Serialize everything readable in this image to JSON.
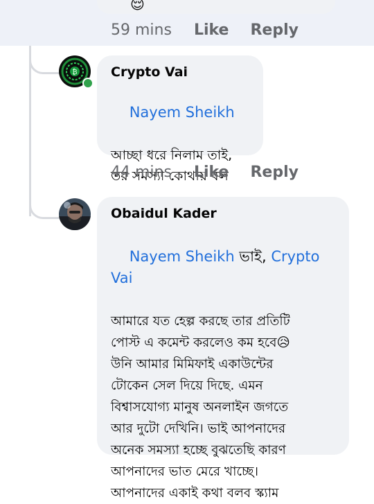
{
  "top_comment": {
    "emoji": "😌",
    "time": "59 mins",
    "like_label": "Like",
    "reply_label": "Reply"
  },
  "comments": [
    {
      "author": "Crypto Vai",
      "mention": "Nayem Sheikh",
      "text": "আচ্ছা ধরে নিলাম তাই,\nতর সমস্যা কোথায় বল",
      "time": "44 mins",
      "like_label": "Like",
      "reply_label": "Reply",
      "online": true
    },
    {
      "author": "Obaidul Kader",
      "mention_1": "Nayem Sheikh",
      "mention_sep": " ভাই, ",
      "mention_2": "Crypto Vai",
      "text_lines": [
        "আমারে যত হেল্প করছে তার প্রতিটি",
        "পোস্ট এ কমেন্ট করলেও কম হবে😥",
        "উনি আমার মিমিফাই একাউন্টের",
        "টোকেন সেল দিয়ে দিছে. এমন",
        "বিশ্বাসযোগ্য মানুষ অনলাইন জগতে",
        "আর দুটো দেখিনি। ভাই আপনাদের",
        "অনেক সমস্যা হচ্ছে বুঝতেছি কারণ",
        "আপনাদের ভাত মেরে খাচ্ছে।",
        "আপনাদের একাই কথা বলব স্ক্যাম"
      ]
    }
  ],
  "colors": {
    "link": "#216fdb",
    "meta": "#65676b",
    "bubble": "#f0f2f5",
    "online": "#31a24c"
  }
}
